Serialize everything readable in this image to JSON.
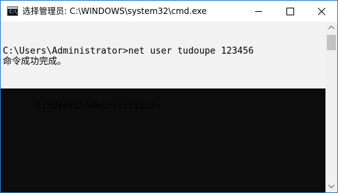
{
  "window": {
    "title": "选择管理员: C:\\WINDOWS\\system32\\cmd.exe",
    "icon": "cmd-icon",
    "icon_glyph": "C:\\.",
    "controls": [
      "minimize-icon",
      "maximize-icon",
      "close-icon"
    ]
  },
  "console": {
    "command_line": "C:\\Users\\Administrator>net user tudoupe 123456",
    "result_line": "命令成功完成。",
    "prompt": "C:\\Users\\Administrator>",
    "selection_color": "#f2f2f2",
    "background_color": "#0c0c0c",
    "text_color": "#000000"
  },
  "scrollbar": {
    "up_icon": "scroll-up-arrow-icon",
    "down_icon": "scroll-down-arrow-icon"
  }
}
